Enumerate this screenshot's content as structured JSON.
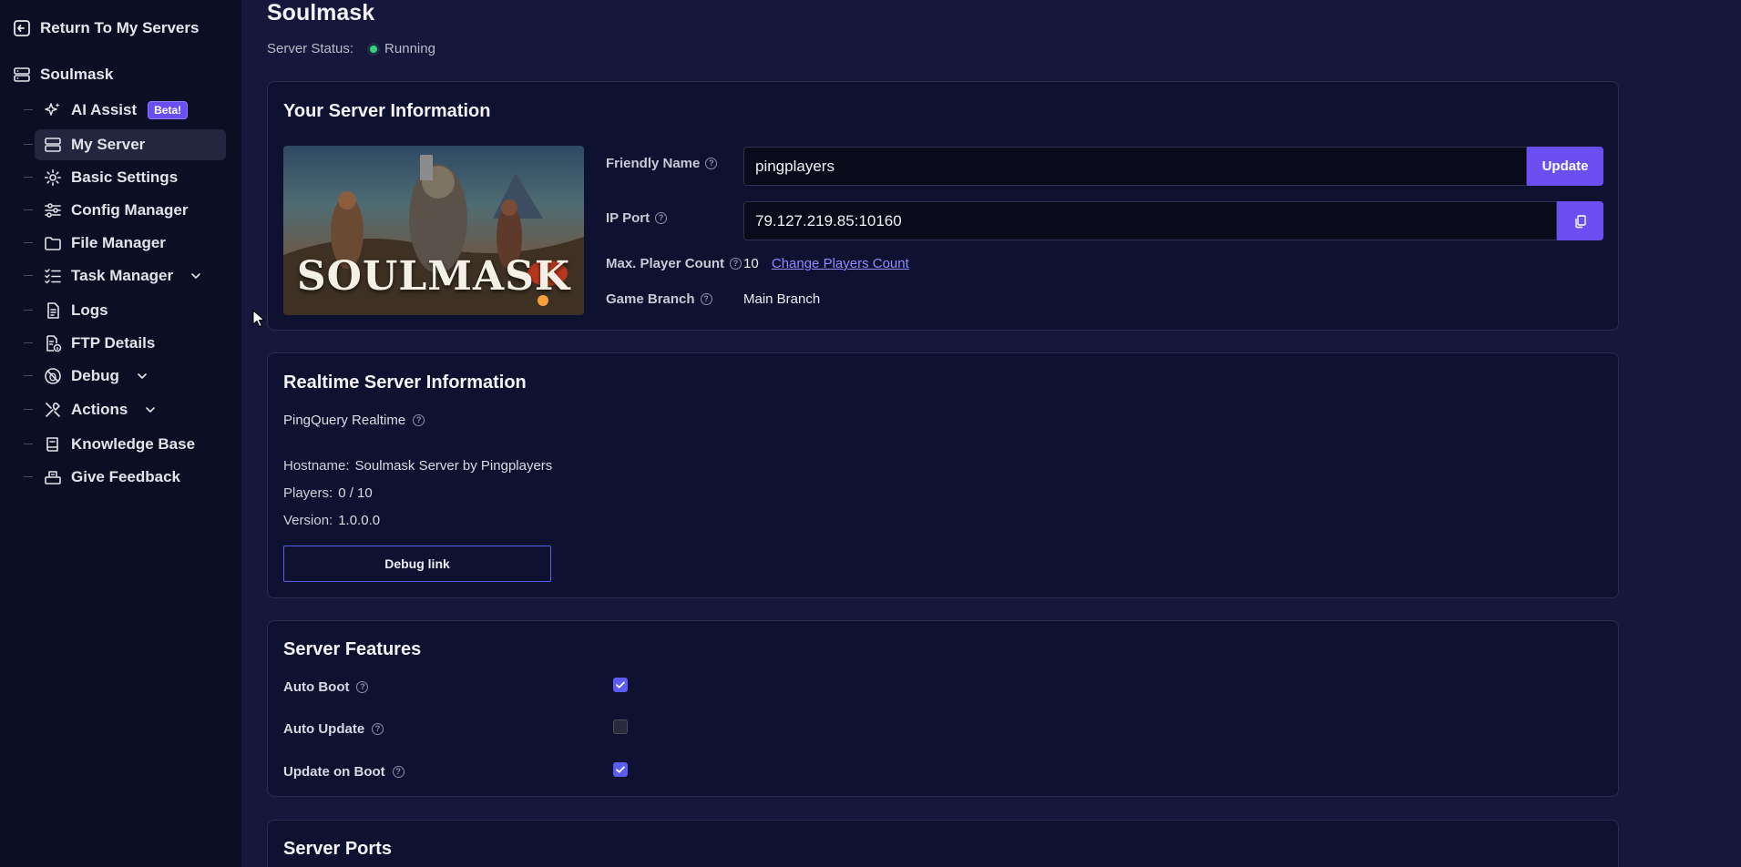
{
  "sidebar": {
    "return_label": "Return To My Servers",
    "server_name": "Soulmask",
    "items": [
      {
        "label": "AI Assist",
        "badge": "Beta!"
      },
      {
        "label": "My Server"
      },
      {
        "label": "Basic Settings"
      },
      {
        "label": "Config Manager"
      },
      {
        "label": "File Manager"
      },
      {
        "label": "Task Manager"
      },
      {
        "label": "Logs"
      },
      {
        "label": "FTP Details"
      },
      {
        "label": "Debug"
      },
      {
        "label": "Actions"
      },
      {
        "label": "Knowledge Base"
      },
      {
        "label": "Give Feedback"
      }
    ]
  },
  "header": {
    "title": "Soulmask",
    "status_label": "Server Status:",
    "status_value": "Running"
  },
  "server_info": {
    "title": "Your Server Information",
    "image_text": "SOULMASK",
    "friendly_name_label": "Friendly Name",
    "friendly_name_value": "pingplayers",
    "update_label": "Update",
    "ip_port_label": "IP Port",
    "ip_port_value": "79.127.219.85:10160",
    "max_player_label": "Max. Player Count",
    "max_player_value": "10",
    "change_players_label": "Change Players Count",
    "game_branch_label": "Game Branch",
    "game_branch_value": "Main Branch"
  },
  "realtime": {
    "title": "Realtime Server Information",
    "pingquery_label": "PingQuery Realtime",
    "hostname_label": "Hostname:",
    "hostname_value": "Soulmask Server by Pingplayers",
    "players_label": "Players:",
    "players_value": "0 / 10",
    "version_label": "Version:",
    "version_value": "1.0.0.0",
    "debug_link_label": "Debug link"
  },
  "features": {
    "title": "Server Features",
    "items": [
      {
        "label": "Auto Boot",
        "checked": true
      },
      {
        "label": "Auto Update",
        "checked": false
      },
      {
        "label": "Update on Boot",
        "checked": true
      }
    ]
  },
  "ports": {
    "title": "Server Ports"
  },
  "colors": {
    "accent": "#6c4ff2",
    "status_running": "#36d17a",
    "sidebar_bg": "#0c0f24",
    "main_bg": "#16173a"
  }
}
